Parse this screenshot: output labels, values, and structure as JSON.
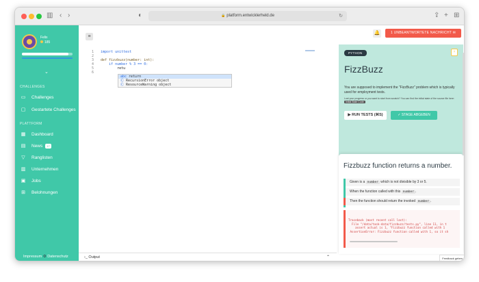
{
  "browser": {
    "url": "platform.entwicklerheld.de"
  },
  "sidebar": {
    "user_name": "Felix",
    "user_points": "185",
    "progress": 0.92,
    "sections": {
      "challenges": "CHALLENGES",
      "platform": "PLATTFORM"
    },
    "items": [
      {
        "label": "Challenges",
        "icon": "monitor-icon"
      },
      {
        "label": "Gestartete Challenges",
        "icon": "laptop-icon"
      },
      {
        "label": "Dashboard",
        "icon": "dashboard-icon"
      },
      {
        "label": "News",
        "icon": "news-icon",
        "badge": "17"
      },
      {
        "label": "Ranglisten",
        "icon": "trophy-icon"
      },
      {
        "label": "Unternehmen",
        "icon": "company-icon"
      },
      {
        "label": "Jobs",
        "icon": "briefcase-icon"
      },
      {
        "label": "Belohnungen",
        "icon": "gift-icon"
      }
    ],
    "footer_impressum": "Impressum",
    "footer_datenschutz": "Datenschutz"
  },
  "editor": {
    "lines": [
      {
        "n": "1",
        "code": "import unittest"
      },
      {
        "n": "2",
        "code": ""
      },
      {
        "n": "3",
        "code": "def fizzbuzz(number: int):"
      },
      {
        "n": "4",
        "code": "    if number % 3 == 0:"
      },
      {
        "n": "5",
        "code": "        retu"
      },
      {
        "n": "6",
        "code": ""
      }
    ],
    "autocomplete": [
      {
        "kind": "abc",
        "label": "return"
      },
      {
        "kind": "Ⓒ",
        "label": "RecursionError object"
      },
      {
        "kind": "Ⓒ",
        "label": "ResourceWarning object"
      }
    ],
    "output_label": "Output"
  },
  "header": {
    "notification": "1 UNBEANTWORTETE NACHRICHT"
  },
  "task": {
    "language": "PYTHON",
    "title": "FizzBuzz",
    "description": "You are supposed to implement the \"FizzBuzz\" problem which is typically used for employment tests.",
    "reset_text": "Lost your progress or you want to start from scratch? You can find the initial state of the source file here:",
    "reset_chip": "Initial State Code",
    "run_tests": "RUN TESTS (⌘S)",
    "submit": "✓ STAGE ABGEBEN"
  },
  "test": {
    "title": "Fizzbuzz function returns a number.",
    "step1_pre": "Given is a",
    "step1_code": "number",
    "step1_post": "which is not divisible by 3 or 5.",
    "step2_pre": "When the function called with this",
    "step2_code": "number",
    "step2_post": ".",
    "step3_pre": "Then the function should return the invoked",
    "step3_code": "number",
    "step3_post": ".",
    "traceback": "Traceback (most recent call last):\n  File \"/data/task-data/fizzbuzz/tests.py\", line 11, in t\n    assert actual is 1, \"Fizzbuzz function called with 1\n AssertionError: Fizzbuzz function called with 1, so it sh"
  },
  "feedback": "Feedback geben"
}
